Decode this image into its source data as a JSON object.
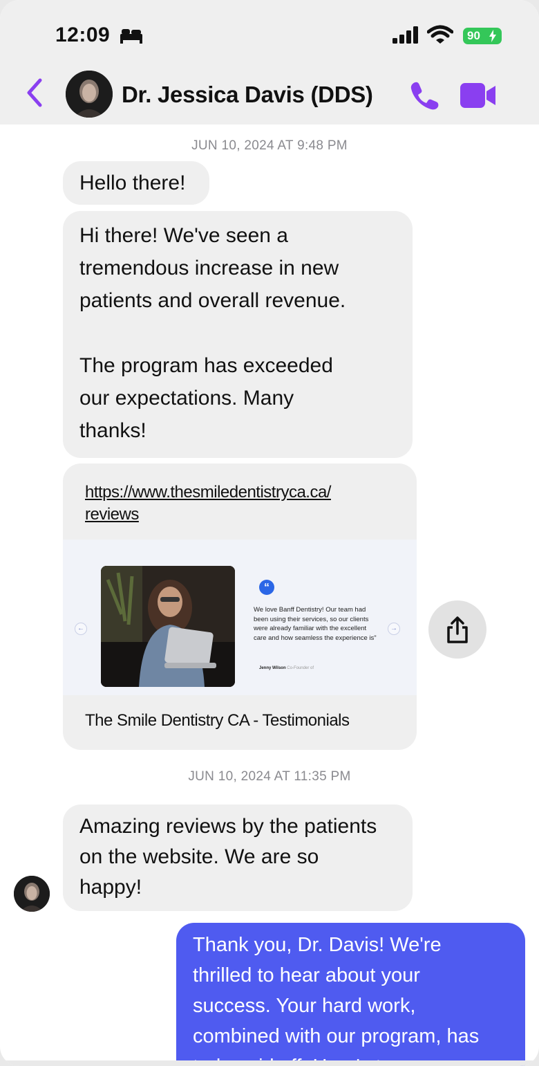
{
  "status_bar": {
    "time": "12:09",
    "battery_level": "90",
    "icons": [
      "bed-icon",
      "signal-icon",
      "wifi-icon",
      "battery-charging-icon"
    ]
  },
  "header": {
    "contact_name": "Dr. Jessica Davis (DDS)",
    "icons": [
      "back-chevron-icon",
      "avatar",
      "phone-icon",
      "video-camera-icon"
    ],
    "accent_color": "#8a3ff0"
  },
  "conversation": {
    "timestamp_1": "JUN 10, 2024 AT 9:48 PM",
    "message_1": "Hello there!",
    "message_2": "Hi there! We've seen a\ntremendous increase in new\npatients and overall revenue.\n\nThe program has exceeded\nour expectations. Many\nthanks!",
    "link_preview": {
      "url_line_1": "https://www.thesmiledentistryca.ca/",
      "url_line_2": "reviews",
      "quote_mark": "“",
      "quote_text": "We love Banff Dentistry! Our team had been using their services, so our clients were already familiar with the excellent care and how seamless the experience is\"",
      "author_name": "Jenny Wilson",
      "author_role": "Co-Founder of",
      "prev_arrow": "←",
      "next_arrow": "→",
      "title": "The Smile Dentistry CA - Testimonials"
    },
    "timestamp_2": "JUN 10, 2024 AT 11:35 PM",
    "message_3": "Amazing reviews by the patients\non the website. We are so\nhappy!",
    "message_4": "Thank you, Dr. Davis! We're\nthrilled to hear about your\nsuccess. Your hard work,\ncombined with our program, has\ntruly paid off. Here's to even"
  },
  "colors": {
    "incoming_bubble": "#efefef",
    "outgoing_bubble": "#4f5bf0",
    "battery": "#34c759"
  }
}
